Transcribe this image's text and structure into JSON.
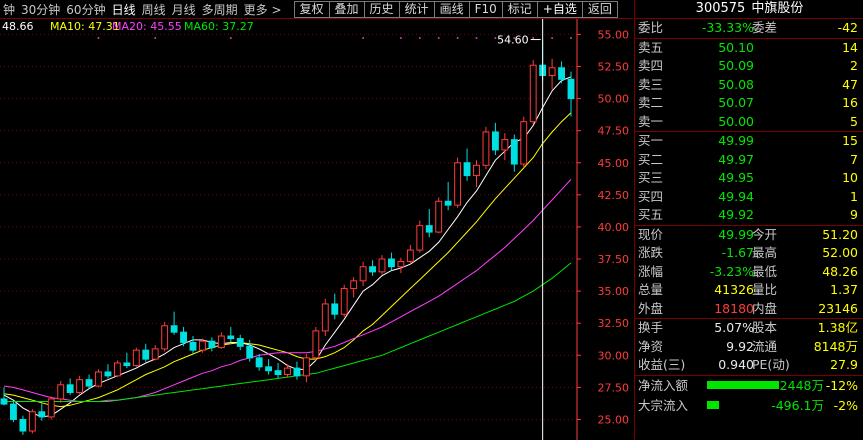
{
  "toolbar": {
    "periods": [
      "钟",
      "30分钟",
      "60分钟",
      "日线",
      "周线",
      "月线",
      "多周期",
      "更多 >"
    ],
    "selected_index": 3,
    "buttons": [
      "复权",
      "叠加",
      "历史",
      "统计",
      "画线",
      "F10",
      "标记",
      "+自选",
      "返回"
    ]
  },
  "chart_header": {
    "ma5": "48.66",
    "ma10": "MA10: 47.31",
    "ma20": "MA20: 45.55",
    "ma60": "MA60: 37.27"
  },
  "colors": {
    "up": "#ff3b3b",
    "down": "#00e0e0",
    "ma5": "#ffffff",
    "ma10": "#ffff00",
    "ma20": "#ff40ff",
    "ma60": "#00e600",
    "grid": "#7a0000",
    "axis": "#ff3b3b"
  },
  "chart_data": {
    "type": "candlestick",
    "y_ticks": [
      "55.00",
      "52.50",
      "50.00",
      "47.50",
      "45.00",
      "42.50",
      "40.00",
      "37.50",
      "35.00",
      "32.50",
      "30.00",
      "27.50",
      "25.00"
    ],
    "ylim": [
      23.4,
      56.2
    ],
    "high_marker": "54.60",
    "candles": [
      [
        26.6,
        27.5,
        26.1,
        26.2
      ],
      [
        26.2,
        26.4,
        24.8,
        25.0
      ],
      [
        25.0,
        25.3,
        23.8,
        24.1
      ],
      [
        24.1,
        25.8,
        23.9,
        25.6
      ],
      [
        25.6,
        26.3,
        24.9,
        25.2
      ],
      [
        25.2,
        26.8,
        25.0,
        26.6
      ],
      [
        26.6,
        28.0,
        26.3,
        27.7
      ],
      [
        27.7,
        28.2,
        26.9,
        27.1
      ],
      [
        27.1,
        28.4,
        27.0,
        28.1
      ],
      [
        28.1,
        28.5,
        27.4,
        27.6
      ],
      [
        27.6,
        28.9,
        27.5,
        28.7
      ],
      [
        28.7,
        29.3,
        28.2,
        28.4
      ],
      [
        28.4,
        29.6,
        28.3,
        29.4
      ],
      [
        29.4,
        30.2,
        29.0,
        29.2
      ],
      [
        29.2,
        30.6,
        29.1,
        30.4
      ],
      [
        30.4,
        30.9,
        29.5,
        29.7
      ],
      [
        29.7,
        30.8,
        29.6,
        30.5
      ],
      [
        30.5,
        32.6,
        30.3,
        32.3
      ],
      [
        32.3,
        33.4,
        31.6,
        31.8
      ],
      [
        31.8,
        32.2,
        30.7,
        31.0
      ],
      [
        31.0,
        31.5,
        30.1,
        30.4
      ],
      [
        30.4,
        31.3,
        30.2,
        31.1
      ],
      [
        31.1,
        31.4,
        30.3,
        30.6
      ],
      [
        30.6,
        31.8,
        30.5,
        31.5
      ],
      [
        31.5,
        32.2,
        31.0,
        31.3
      ],
      [
        31.3,
        31.6,
        30.4,
        30.7
      ],
      [
        30.7,
        31.2,
        29.5,
        29.8
      ],
      [
        29.8,
        30.1,
        28.8,
        29.1
      ],
      [
        29.1,
        29.7,
        28.5,
        28.8
      ],
      [
        28.8,
        29.4,
        28.2,
        28.5
      ],
      [
        28.5,
        29.3,
        28.3,
        29.0
      ],
      [
        29.0,
        29.5,
        28.1,
        28.4
      ],
      [
        28.4,
        30.1,
        27.9,
        29.8
      ],
      [
        29.8,
        32.2,
        29.6,
        31.9
      ],
      [
        31.9,
        34.4,
        31.5,
        34.0
      ],
      [
        34.0,
        34.8,
        32.8,
        33.2
      ],
      [
        33.2,
        35.5,
        33.0,
        35.2
      ],
      [
        35.2,
        36.1,
        34.5,
        35.8
      ],
      [
        35.8,
        37.3,
        35.4,
        36.9
      ],
      [
        36.9,
        37.4,
        36.2,
        36.5
      ],
      [
        36.5,
        37.8,
        36.3,
        37.5
      ],
      [
        37.5,
        38.0,
        36.6,
        36.9
      ],
      [
        36.9,
        37.6,
        36.4,
        37.3
      ],
      [
        37.3,
        38.6,
        37.1,
        38.2
      ],
      [
        38.2,
        40.5,
        38.0,
        40.1
      ],
      [
        40.1,
        41.4,
        39.2,
        39.6
      ],
      [
        39.6,
        42.3,
        39.5,
        42.0
      ],
      [
        42.0,
        43.5,
        41.3,
        41.7
      ],
      [
        41.7,
        45.4,
        41.5,
        45.0
      ],
      [
        45.0,
        46.1,
        43.6,
        44.0
      ],
      [
        44.0,
        45.2,
        43.1,
        44.8
      ],
      [
        44.8,
        47.8,
        44.5,
        47.4
      ],
      [
        47.4,
        48.1,
        45.6,
        46.0
      ],
      [
        46.0,
        47.3,
        45.2,
        46.8
      ],
      [
        46.8,
        47.2,
        44.3,
        44.9
      ],
      [
        44.9,
        48.6,
        44.6,
        48.2
      ],
      [
        48.2,
        53.0,
        48.0,
        52.6
      ],
      [
        52.6,
        54.6,
        51.4,
        51.8
      ],
      [
        51.8,
        53.1,
        50.7,
        52.4
      ],
      [
        52.4,
        52.9,
        51.2,
        51.5
      ],
      [
        51.5,
        52.1,
        48.6,
        50.0
      ]
    ],
    "series": [
      {
        "key": "ma5",
        "values": [
          26.9,
          26.5,
          25.9,
          25.5,
          25.2,
          25.3,
          25.8,
          26.3,
          26.9,
          27.4,
          27.8,
          28.1,
          28.4,
          28.7,
          29.0,
          29.4,
          29.7,
          30.1,
          30.6,
          30.9,
          31.2,
          31.2,
          31.0,
          30.9,
          31.0,
          31.0,
          30.8,
          30.5,
          30.1,
          29.7,
          29.2,
          28.9,
          28.9,
          29.6,
          30.8,
          31.8,
          32.8,
          33.9,
          35.0,
          35.5,
          36.2,
          36.6,
          36.8,
          37.1,
          37.6,
          38.1,
          38.8,
          39.8,
          40.8,
          41.9,
          42.8,
          44.0,
          45.2,
          45.9,
          46.6,
          46.9,
          47.9,
          49.3,
          50.6,
          51.4,
          51.7
        ]
      },
      {
        "key": "ma10",
        "values": [
          27.0,
          26.9,
          26.7,
          26.5,
          26.3,
          26.1,
          26.0,
          26.1,
          26.3,
          26.5,
          26.7,
          27.0,
          27.3,
          27.7,
          28.1,
          28.5,
          28.8,
          29.1,
          29.5,
          29.8,
          30.1,
          30.4,
          30.6,
          30.8,
          30.9,
          31.0,
          30.9,
          30.8,
          30.6,
          30.4,
          30.2,
          29.9,
          29.7,
          29.7,
          29.9,
          30.2,
          30.6,
          31.2,
          31.9,
          32.4,
          33.1,
          33.8,
          34.5,
          35.2,
          35.9,
          36.6,
          37.3,
          38.0,
          38.8,
          39.6,
          40.4,
          41.3,
          42.2,
          43.0,
          43.8,
          44.6,
          45.4,
          46.5,
          47.4,
          48.2,
          48.9
        ]
      },
      {
        "key": "ma20",
        "values": [
          27.6,
          27.5,
          27.3,
          27.1,
          26.9,
          26.7,
          26.6,
          26.5,
          26.4,
          26.4,
          26.4,
          26.4,
          26.5,
          26.6,
          26.7,
          26.9,
          27.1,
          27.4,
          27.7,
          28.0,
          28.3,
          28.6,
          28.8,
          29.1,
          29.3,
          29.6,
          29.8,
          30.0,
          30.1,
          30.2,
          30.2,
          30.2,
          30.2,
          30.3,
          30.5,
          30.7,
          31.0,
          31.3,
          31.6,
          31.9,
          32.2,
          32.6,
          33.0,
          33.4,
          33.8,
          34.2,
          34.6,
          35.1,
          35.6,
          36.1,
          36.6,
          37.2,
          37.8,
          38.4,
          39.1,
          39.8,
          40.5,
          41.3,
          42.1,
          42.9,
          43.7
        ]
      },
      {
        "key": "ma60",
        "values": [
          26.4,
          26.4,
          26.4,
          26.4,
          26.4,
          26.4,
          26.4,
          26.4,
          26.4,
          26.4,
          26.4,
          26.5,
          26.5,
          26.6,
          26.7,
          26.8,
          26.9,
          27.0,
          27.1,
          27.2,
          27.3,
          27.4,
          27.5,
          27.6,
          27.7,
          27.8,
          27.9,
          28.0,
          28.1,
          28.2,
          28.3,
          28.4,
          28.5,
          28.6,
          28.8,
          29.0,
          29.2,
          29.4,
          29.6,
          29.8,
          30.0,
          30.3,
          30.6,
          30.9,
          31.2,
          31.5,
          31.8,
          32.1,
          32.4,
          32.7,
          33.0,
          33.3,
          33.6,
          33.9,
          34.2,
          34.6,
          35.0,
          35.5,
          36.0,
          36.6,
          37.2
        ]
      }
    ]
  },
  "panel": {
    "code": "300575",
    "name": "中旗股份",
    "weibi": {
      "label": "委比",
      "value": "-33.33%",
      "label2": "委差",
      "value2": "-42"
    },
    "asks": [
      {
        "label": "卖五",
        "price": "50.10",
        "vol": "14"
      },
      {
        "label": "卖四",
        "price": "50.09",
        "vol": "2"
      },
      {
        "label": "卖三",
        "price": "50.08",
        "vol": "47"
      },
      {
        "label": "卖二",
        "price": "50.07",
        "vol": "16"
      },
      {
        "label": "卖一",
        "price": "50.00",
        "vol": "5"
      }
    ],
    "bids": [
      {
        "label": "买一",
        "price": "49.99",
        "vol": "15"
      },
      {
        "label": "买二",
        "price": "49.97",
        "vol": "7"
      },
      {
        "label": "买三",
        "price": "49.95",
        "vol": "10"
      },
      {
        "label": "买四",
        "price": "49.94",
        "vol": "1"
      },
      {
        "label": "买五",
        "price": "49.92",
        "vol": "9"
      }
    ],
    "quote": [
      {
        "l1": "现价",
        "v1": "49.99",
        "c1": "green",
        "l2": "今开",
        "v2": "51.20",
        "c2": "red"
      },
      {
        "l1": "涨跌",
        "v1": "-1.67",
        "c1": "green",
        "l2": "最高",
        "v2": "52.00",
        "c2": "red"
      },
      {
        "l1": "涨幅",
        "v1": "-3.23%",
        "c1": "green",
        "l2": "最低",
        "v2": "48.26",
        "c2": "green"
      },
      {
        "l1": "总量",
        "v1": "41326",
        "c1": "yellow",
        "l2": "量比",
        "v2": "1.37",
        "c2": "red"
      },
      {
        "l1": "外盘",
        "v1": "18180",
        "c1": "red",
        "l2": "内盘",
        "v2": "23146",
        "c2": "green"
      }
    ],
    "fund": [
      {
        "l1": "换手",
        "v1": "5.07%",
        "l2": "股本",
        "v2": "1.38亿"
      },
      {
        "l1": "净资",
        "v1": "9.92",
        "l2": "流通",
        "v2": "8148万"
      },
      {
        "l1": "收益(三)",
        "v1": "0.940",
        "l2": "PE(动)",
        "v2": "27.9"
      }
    ],
    "flows": [
      {
        "label": "净流入额",
        "value": "-2448万",
        "pct": "-12%",
        "bar": 0.12
      },
      {
        "label": "大宗流入",
        "value": "-496.1万",
        "pct": "-2%",
        "bar": 0.02
      }
    ]
  }
}
